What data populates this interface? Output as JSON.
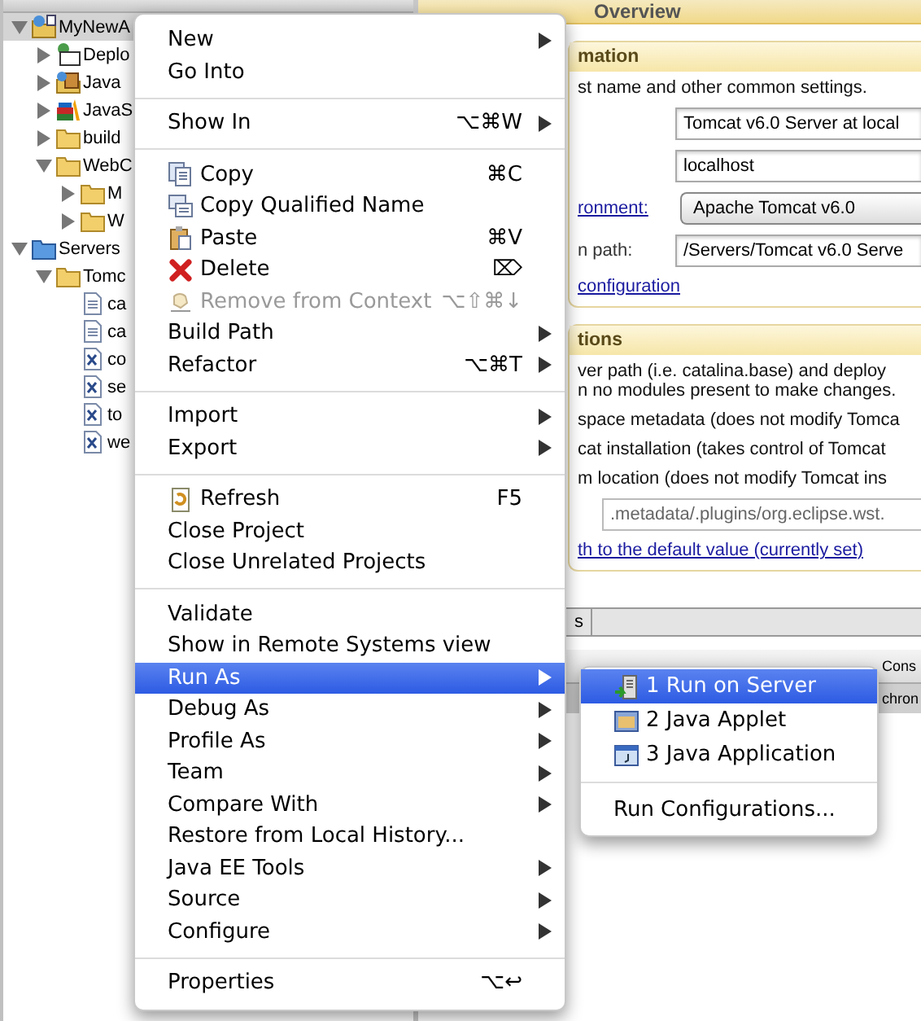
{
  "tree": [
    {
      "label": "MyNewA",
      "kind": "project",
      "expanded": true,
      "selected": true,
      "children": [
        {
          "label": "Deplo",
          "kind": "descriptor",
          "expanded": false,
          "selected": false
        },
        {
          "label": "Java",
          "kind": "java",
          "expanded": false,
          "selected": false
        },
        {
          "label": "JavaS",
          "kind": "books",
          "expanded": false,
          "selected": false
        },
        {
          "label": "build",
          "kind": "folder",
          "expanded": false,
          "selected": false
        },
        {
          "label": "WebC",
          "kind": "folder",
          "expanded": true,
          "selected": false,
          "children": [
            {
              "label": "M",
              "kind": "folder",
              "expanded": false,
              "selected": false
            },
            {
              "label": "W",
              "kind": "folder",
              "expanded": false,
              "selected": false
            }
          ]
        }
      ]
    },
    {
      "label": "Servers",
      "kind": "server_folder",
      "expanded": true,
      "selected": false,
      "children": [
        {
          "label": "Tomc",
          "kind": "folder",
          "expanded": true,
          "selected": false,
          "children": [
            {
              "label": "ca",
              "kind": "text",
              "selected": false
            },
            {
              "label": "ca",
              "kind": "text",
              "selected": false
            },
            {
              "label": "co",
              "kind": "xml",
              "selected": false
            },
            {
              "label": "se",
              "kind": "xml",
              "selected": false
            },
            {
              "label": "to",
              "kind": "xml",
              "selected": false
            },
            {
              "label": "we",
              "kind": "xml",
              "selected": false
            }
          ]
        }
      ]
    }
  ],
  "editor": {
    "title": "Overview",
    "general": {
      "heading": "mation",
      "description": "st name and other common settings.",
      "fields": [
        {
          "kind": "text",
          "value": "Tomcat v6.0 Server at local"
        },
        {
          "kind": "text",
          "value": "localhost"
        },
        {
          "kind": "dropdown",
          "label": "ronment:",
          "label_is_link": true,
          "value": "Apache Tomcat v6.0"
        },
        {
          "kind": "text",
          "label": "n path:",
          "label_is_link": false,
          "value": "/Servers/Tomcat v6.0 Serve"
        }
      ],
      "link": "configuration"
    },
    "locations": {
      "heading": "tions",
      "description": [
        "ver path (i.e. catalina.base) and deploy",
        "n no modules present to make changes."
      ],
      "options": [
        "space metadata (does not modify Tomca",
        "cat installation (takes control of Tomcat",
        "m location (does not modify Tomcat ins"
      ],
      "path": ".metadata/.plugins/org.eclipse.wst.",
      "link": "th to the default value (currently set)"
    },
    "tab": "s",
    "console": {
      "tab": "Cons",
      "line": "chron"
    }
  },
  "context_menu": {
    "items": [
      {
        "kind": "item",
        "label": "New",
        "arrow": true,
        "disabled": false,
        "selected": false
      },
      {
        "kind": "item",
        "label": "Go Into",
        "arrow": false,
        "disabled": false,
        "selected": false
      },
      {
        "kind": "separator"
      },
      {
        "kind": "item",
        "label": "Show In",
        "shortcut": "⌥⌘W",
        "arrow": true,
        "disabled": false,
        "selected": false
      },
      {
        "kind": "separator"
      },
      {
        "kind": "copy",
        "label": "Copy",
        "shortcut": "⌘C",
        "arrow": false,
        "disabled": false,
        "selected": false
      },
      {
        "kind": "copy_name",
        "label": "Copy Qualified Name",
        "arrow": false,
        "disabled": false,
        "selected": false
      },
      {
        "kind": "paste",
        "label": "Paste",
        "shortcut": "⌘V",
        "arrow": false,
        "disabled": false,
        "selected": false
      },
      {
        "kind": "delete",
        "label": "Delete",
        "shortcut": "⌦",
        "arrow": false,
        "disabled": false,
        "selected": false
      },
      {
        "kind": "remove",
        "label": "Remove from Context",
        "shortcut": "⌥⇧⌘↓",
        "arrow": false,
        "disabled": true,
        "selected": false
      },
      {
        "kind": "item",
        "label": "Build Path",
        "arrow": true,
        "disabled": false,
        "selected": false
      },
      {
        "kind": "item",
        "label": "Refactor",
        "shortcut": "⌥⌘T",
        "arrow": true,
        "disabled": false,
        "selected": false
      },
      {
        "kind": "separator"
      },
      {
        "kind": "item",
        "label": "Import",
        "arrow": true,
        "disabled": false,
        "selected": false
      },
      {
        "kind": "item",
        "label": "Export",
        "arrow": true,
        "disabled": false,
        "selected": false
      },
      {
        "kind": "separator"
      },
      {
        "kind": "refresh",
        "label": "Refresh",
        "shortcut": "F5",
        "arrow": false,
        "disabled": false,
        "selected": false
      },
      {
        "kind": "item",
        "label": "Close Project",
        "arrow": false,
        "disabled": false,
        "selected": false
      },
      {
        "kind": "item",
        "label": "Close Unrelated Projects",
        "arrow": false,
        "disabled": false,
        "selected": false
      },
      {
        "kind": "separator"
      },
      {
        "kind": "item",
        "label": "Validate",
        "arrow": false,
        "disabled": false,
        "selected": false
      },
      {
        "kind": "item",
        "label": "Show in Remote Systems view",
        "arrow": false,
        "disabled": false,
        "selected": false
      },
      {
        "kind": "item",
        "label": "Run As",
        "arrow": true,
        "disabled": false,
        "selected": true
      },
      {
        "kind": "item",
        "label": "Debug As",
        "arrow": true,
        "disabled": false,
        "selected": false
      },
      {
        "kind": "item",
        "label": "Profile As",
        "arrow": true,
        "disabled": false,
        "selected": false
      },
      {
        "kind": "item",
        "label": "Team",
        "arrow": true,
        "disabled": false,
        "selected": false
      },
      {
        "kind": "item",
        "label": "Compare With",
        "arrow": true,
        "disabled": false,
        "selected": false
      },
      {
        "kind": "item",
        "label": "Restore from Local History...",
        "arrow": false,
        "disabled": false,
        "selected": false
      },
      {
        "kind": "item",
        "label": "Java EE Tools",
        "arrow": true,
        "disabled": false,
        "selected": false
      },
      {
        "kind": "item",
        "label": "Source",
        "arrow": true,
        "disabled": false,
        "selected": false
      },
      {
        "kind": "item",
        "label": "Configure",
        "arrow": true,
        "disabled": false,
        "selected": false
      },
      {
        "kind": "separator"
      },
      {
        "kind": "item",
        "label": "Properties",
        "shortcut": "⌥↩",
        "arrow": false,
        "disabled": false,
        "selected": false
      }
    ]
  },
  "submenu": {
    "items": [
      {
        "kind": "server",
        "label": "1 Run on Server",
        "selected": true
      },
      {
        "kind": "applet",
        "label": "2 Java Applet",
        "selected": false
      },
      {
        "kind": "application",
        "label": "3 Java Application",
        "selected": false
      },
      {
        "kind": "separator"
      },
      {
        "kind": "item",
        "label": "Run Configurations...",
        "selected": false
      }
    ]
  }
}
